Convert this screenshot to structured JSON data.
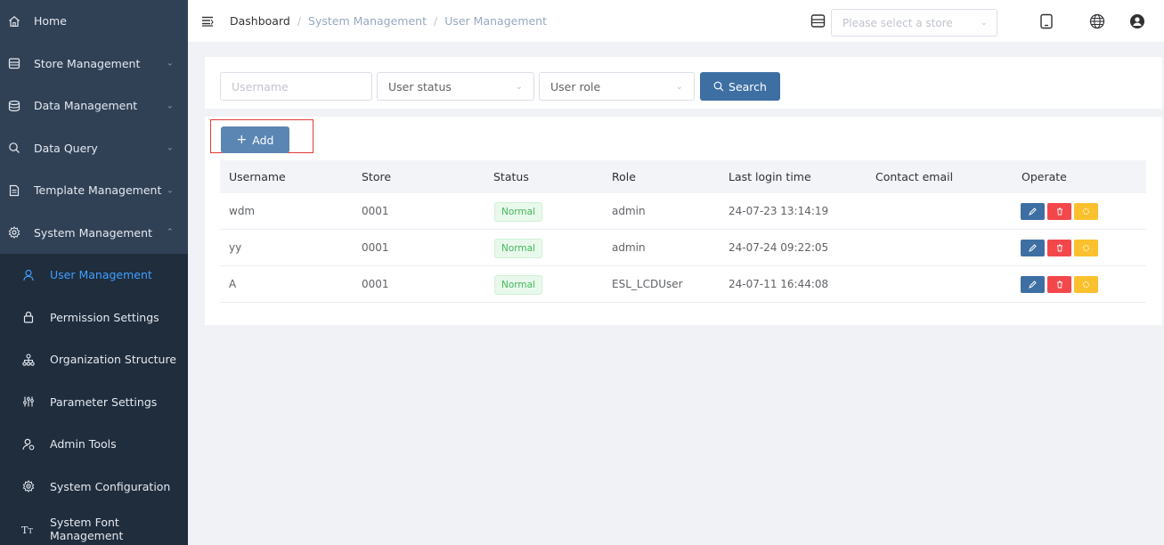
{
  "sidebar": {
    "items": [
      {
        "label": "Home",
        "icon": "home-icon"
      },
      {
        "label": "Store Management",
        "icon": "store-icon"
      },
      {
        "label": "Data Management",
        "icon": "database-icon"
      },
      {
        "label": "Data Query",
        "icon": "search-icon"
      },
      {
        "label": "Template Management",
        "icon": "template-icon"
      },
      {
        "label": "System Management",
        "icon": "gear-icon"
      }
    ],
    "submenu": [
      {
        "label": "User Management",
        "icon": "user-icon",
        "active": true
      },
      {
        "label": "Permission Settings",
        "icon": "lock-icon"
      },
      {
        "label": "Organization Structure",
        "icon": "org-chart-icon"
      },
      {
        "label": "Parameter Settings",
        "icon": "sliders-icon"
      },
      {
        "label": "Admin Tools",
        "icon": "admin-user-icon"
      },
      {
        "label": "System Configuration",
        "icon": "config-icon"
      },
      {
        "label": "System Font Management",
        "icon": "font-icon"
      }
    ]
  },
  "header": {
    "breadcrumb": [
      "Dashboard",
      "System Management",
      "User Management"
    ],
    "breadcrumb_sep": "/",
    "store_select_placeholder": "Please select a store"
  },
  "search": {
    "username_placeholder": "Username",
    "status_placeholder": "User status",
    "role_placeholder": "User role",
    "search_label": "Search"
  },
  "table": {
    "add_label": "Add",
    "columns": [
      "Username",
      "Store",
      "Status",
      "Role",
      "Last login time",
      "Contact email",
      "Operate"
    ],
    "rows": [
      {
        "username": "wdm",
        "store": "0001",
        "status": "Normal",
        "role": "admin",
        "last_login": "24-07-23 13:14:19",
        "email": ""
      },
      {
        "username": "yy",
        "store": "0001",
        "status": "Normal",
        "role": "admin",
        "last_login": "24-07-24 09:22:05",
        "email": ""
      },
      {
        "username": "A",
        "store": "0001",
        "status": "Normal",
        "role": "ESL_LCDUser",
        "last_login": "24-07-11 16:44:08",
        "email": ""
      }
    ]
  },
  "colors": {
    "sidebar_bg": "#304156",
    "submenu_bg": "#1f2d3d",
    "active_menu": "#409eff",
    "primary_button": "#3e6fa3",
    "delete_button": "#f4474b",
    "reset_button": "#fbc02d",
    "status_normal": "#46b85b"
  }
}
